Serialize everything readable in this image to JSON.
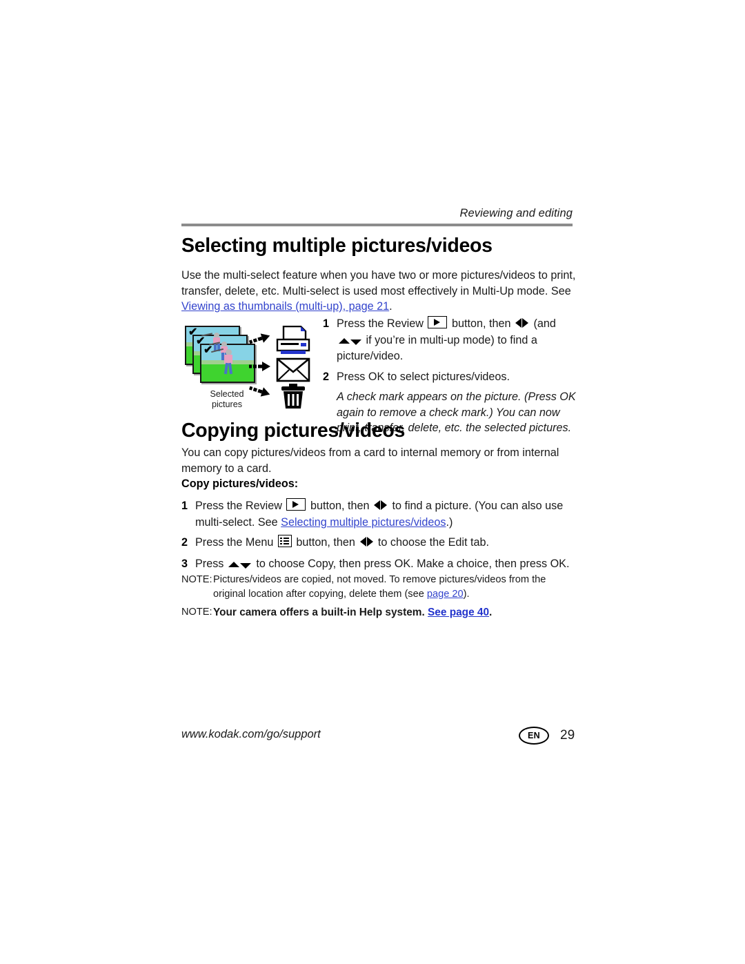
{
  "document": {
    "running_header": "Reviewing and editing",
    "footer_url": "www.kodak.com/go/support",
    "language_badge": "EN",
    "page_number": "29"
  },
  "colors": {
    "link_blue": "#3344cc",
    "header_rule_gray": "#8c8c8c",
    "text_black": "#1a1a1a",
    "photo_sky": "#87d3e6",
    "photo_grass": "#3fd32f",
    "printer_accent": "#2233cc"
  },
  "sections": [
    {
      "heading": "Selecting multiple pictures/videos",
      "intro_before_link": "Use the multi-select feature when you have two or more pictures/videos to print, transfer, delete, etc. Multi-select is used most effectively in Multi-Up mode. See ",
      "intro_link": "Viewing as thumbnails (multi-up), page 21",
      "intro_after_link": ".",
      "steps": [
        {
          "number": "1",
          "text_a": "Press the Review ",
          "icon_a": "review-button-icon",
          "text_b": " button, then ",
          "icon_b": "left-right-arrows-icon",
          "text_c": " (and ",
          "icon_c": "up-down-arrows-icon",
          "text_d": " if you’re in multi-up mode) to find a picture/video."
        },
        {
          "number": "2",
          "text_a": "Press OK to select pictures/videos.",
          "text_b": "",
          "text_c": "",
          "text_d": ""
        }
      ],
      "italic_note": "A check mark appears on the picture. (Press OK again to remove a check mark.) You can now print, transfer, delete, etc. the selected pictures."
    },
    {
      "heading": "Copying pictures/videos",
      "intro": "You can copy pictures/videos from a card to internal memory or from internal memory to a card.",
      "subheading": "Copy pictures/videos:",
      "steps": [
        {
          "number": "1",
          "text_a": "Press the Review ",
          "icon_a": "review-button-icon",
          "text_b": " button, then ",
          "icon_b": "left-right-arrows-icon",
          "text_c": " to find a picture. (You can also use multi-select. See ",
          "link": "Selecting multiple pictures/videos",
          "text_d": ".)"
        },
        {
          "number": "2",
          "text_a": "Press the Menu ",
          "icon_a": "menu-button-icon",
          "text_b": " button, then ",
          "icon_b": "left-right-arrows-icon",
          "text_c": " to choose the Edit tab.",
          "text_d": ""
        },
        {
          "number": "3",
          "text_a": "Press ",
          "icon_a": "up-down-arrows-icon",
          "text_b": " to choose Copy, then press OK. Make a choice, then press OK.",
          "text_c": "",
          "text_d": ""
        }
      ]
    }
  ],
  "notes": [
    {
      "label": "NOTE:",
      "text_before_link": "Pictures/videos are copied, not moved. To remove pictures/videos from the original location after copying, delete them (see ",
      "link": "page 20",
      "text_after_link": ")."
    },
    {
      "label": "NOTE:",
      "text_before_link": "Your camera offers a built-in Help system. ",
      "link": "See page 40",
      "text_after_link": "."
    }
  ],
  "illustration": {
    "caption_line1": "Selected",
    "caption_line2": "pictures",
    "photo_count": "3",
    "destinations": [
      "printer-icon",
      "envelope-icon",
      "trash-icon"
    ],
    "arrows": [
      "arrow-to-printer",
      "arrow-to-envelope",
      "arrow-to-trash"
    ]
  }
}
